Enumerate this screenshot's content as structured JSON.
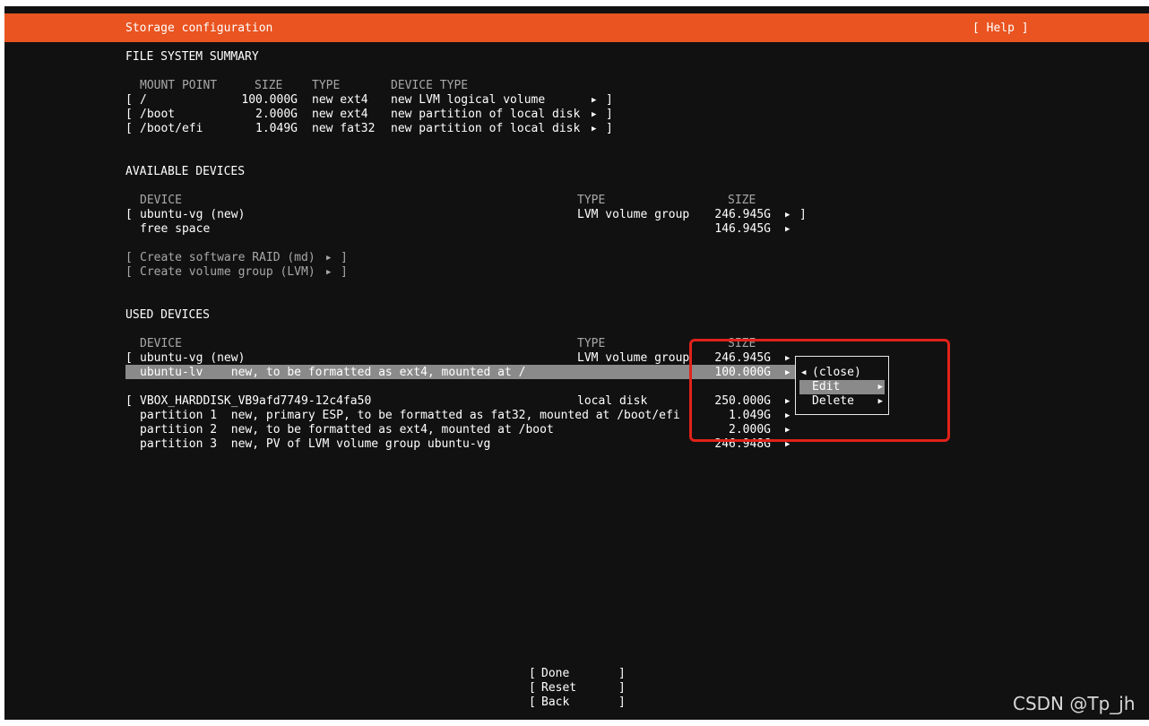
{
  "header": {
    "title": "Storage configuration",
    "help": "[ Help ]"
  },
  "fs_summary": {
    "heading": "FILE SYSTEM SUMMARY",
    "columns": [
      "MOUNT POINT",
      "SIZE",
      "TYPE",
      "DEVICE TYPE"
    ],
    "rows": [
      {
        "mount": "/",
        "size": "100.000G",
        "type": "new ext4",
        "device_type": "new LVM logical volume"
      },
      {
        "mount": "/boot",
        "size": "2.000G",
        "type": "new ext4",
        "device_type": "new partition of local disk"
      },
      {
        "mount": "/boot/efi",
        "size": "1.049G",
        "type": "new fat32",
        "device_type": "new partition of local disk"
      }
    ]
  },
  "available": {
    "heading": "AVAILABLE DEVICES",
    "columns": [
      "DEVICE",
      "TYPE",
      "SIZE"
    ],
    "rows": [
      {
        "device": "ubuntu-vg (new)",
        "type": "LVM volume group",
        "size": "246.945G"
      },
      {
        "device": "free space",
        "type": "",
        "size": "146.945G"
      }
    ],
    "actions": [
      "Create software RAID (md)",
      "Create volume group (LVM)"
    ]
  },
  "used": {
    "heading": "USED DEVICES",
    "columns": [
      "DEVICE",
      "TYPE",
      "SIZE"
    ],
    "rows": [
      {
        "device": "ubuntu-vg (new)",
        "type": "LVM volume group",
        "size": "246.945G"
      },
      {
        "device": "ubuntu-lv    new, to be formatted as ext4, mounted at /",
        "type": "",
        "size": "100.000G"
      },
      {
        "device": "VBOX_HARDDISK_VB9afd7749-12c4fa50",
        "type": "local disk",
        "size": "250.000G"
      },
      {
        "device": "partition 1  new, primary ESP, to be formatted as fat32, mounted at /boot/efi",
        "type": "",
        "size": "1.049G"
      },
      {
        "device": "partition 2  new, to be formatted as ext4, mounted at /boot",
        "type": "",
        "size": "2.000G"
      },
      {
        "device": "partition 3  new, PV of LVM volume group ubuntu-vg",
        "type": "",
        "size": "246.948G"
      }
    ]
  },
  "context_menu": {
    "items": [
      "(close)",
      "Edit",
      "Delete"
    ],
    "selected": "Edit"
  },
  "footer": {
    "buttons": [
      "Done",
      "Reset",
      "Back"
    ]
  },
  "watermark": "CSDN @Tp_jh",
  "colors": {
    "accent": "#e95420",
    "background": "#111111",
    "highlight": "#8a8a8a",
    "annotation": "#e0221b"
  }
}
